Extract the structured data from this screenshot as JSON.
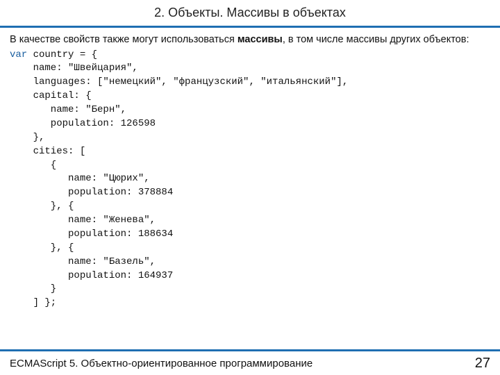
{
  "header": {
    "title": "2. Объекты. Массивы в объектах"
  },
  "intro": {
    "before_bold": "В качестве свойств также могут использоваться ",
    "bold": "массивы",
    "after_bold": ", в том числе массивы других объектов:"
  },
  "code": {
    "keyword_var": "var",
    "line01": " country = {",
    "line02": "    name: \"Швейцария\",",
    "line03": "    languages: [\"немецкий\", \"французский\", \"итальянский\"],",
    "line04": "    capital: {",
    "line05": "       name: \"Берн\",",
    "line06": "       population: 126598",
    "line07": "    },",
    "line08": "    cities: [",
    "line09": "       {",
    "line10": "          name: \"Цюрих\",",
    "line11": "          population: 378884",
    "line12": "       }, {",
    "line13": "          name: \"Женева\",",
    "line14": "          population: 188634",
    "line15": "       }, {",
    "line16": "          name: \"Базель\",",
    "line17": "          population: 164937",
    "line18": "       }",
    "line19": "    ] };"
  },
  "footer": {
    "title": "ECMAScript 5. Объектно-ориентированное программирование",
    "page": "27"
  }
}
